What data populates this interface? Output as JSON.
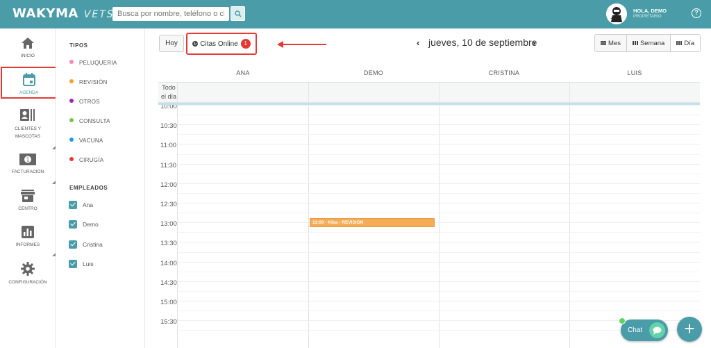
{
  "app": {
    "logo": "WAKYMA",
    "logo_suffix": "VETS"
  },
  "search": {
    "placeholder": "Busca por nombre, teléfono o chip"
  },
  "user": {
    "greeting": "HOLA, DEMO",
    "role": "PROPIETARIO"
  },
  "sidebar": {
    "items": [
      {
        "label": "INICIO",
        "icon": "home-icon"
      },
      {
        "label": "AGENDA",
        "icon": "calendar-icon",
        "active": true
      },
      {
        "label": "CLIENTES Y MASCOTAS",
        "icon": "contacts-icon"
      },
      {
        "label": "FACTURACIÓN",
        "icon": "money-icon"
      },
      {
        "label": "CENTRO",
        "icon": "store-icon"
      },
      {
        "label": "INFORMES",
        "icon": "chart-icon"
      },
      {
        "label": "CONFIGURACIÓN",
        "icon": "gear-icon"
      }
    ]
  },
  "filters": {
    "types_title": "TIPOS",
    "types": [
      {
        "label": "PELUQUERIA",
        "color": "#f28bb2"
      },
      {
        "label": "REVISIÓN",
        "color": "#f7a031"
      },
      {
        "label": "OTROS",
        "color": "#9c27b0"
      },
      {
        "label": "CONSULTA",
        "color": "#7cc34a"
      },
      {
        "label": "VACUNA",
        "color": "#2196f3"
      },
      {
        "label": "CIRUGÍA",
        "color": "#e53935"
      }
    ],
    "employees_title": "EMPLEADOS",
    "employees": [
      "Ana",
      "Demo",
      "Cristina",
      "Luis"
    ]
  },
  "toolbar": {
    "today": "Hoy",
    "online": "Citas Online",
    "online_count": "1",
    "date": "jueves, 10 de septiembre",
    "views": [
      "Mes",
      "Semana",
      "Día"
    ]
  },
  "calendar": {
    "columns": [
      "ANA",
      "DEMO",
      "CRISTINA",
      "LUIS"
    ],
    "allday_label": "Todo el día",
    "times": [
      "10:00",
      "10:30",
      "11:00",
      "11:30",
      "12:00",
      "12:30",
      "13:00",
      "13:30",
      "14:00",
      "14:30",
      "15:00",
      "15:30"
    ],
    "event": {
      "label": "13:00 - Kiba - REVISIÓN",
      "column": "DEMO",
      "color": "#f5ac57"
    }
  },
  "chat": {
    "label": "Chat"
  },
  "fab": {
    "label": "+"
  }
}
